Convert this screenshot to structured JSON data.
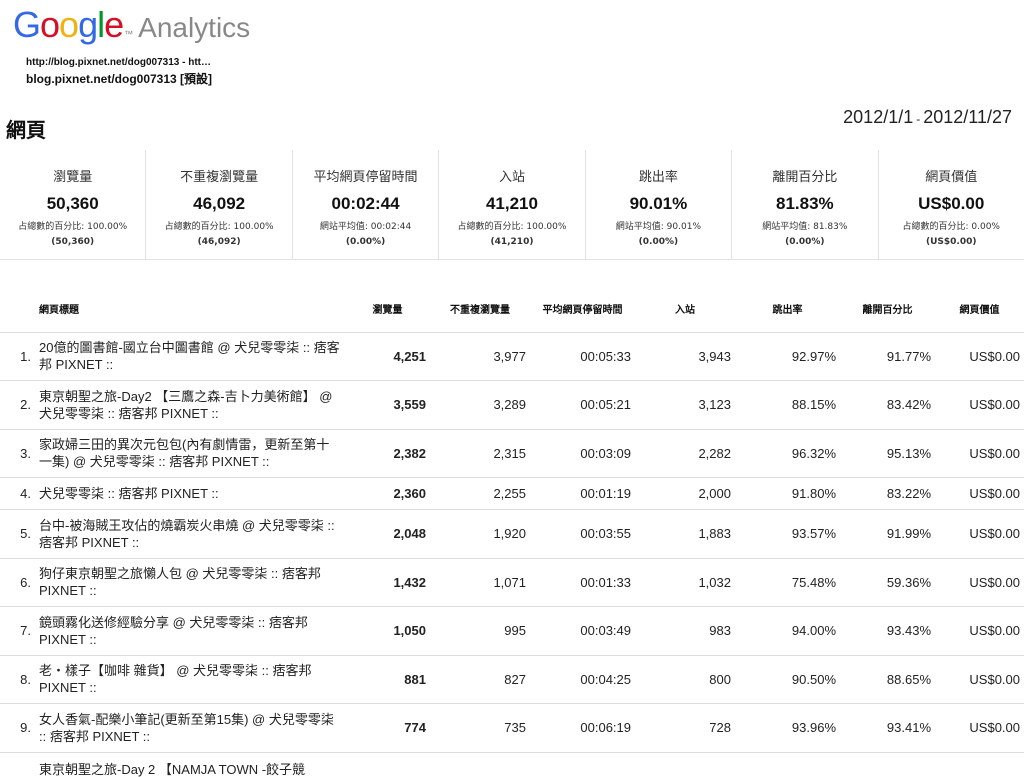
{
  "header": {
    "logo": {
      "letters": [
        {
          "char": "G",
          "color": "#3369e8"
        },
        {
          "char": "o",
          "color": "#d50f25"
        },
        {
          "char": "o",
          "color": "#eeb211"
        },
        {
          "char": "g",
          "color": "#3369e8"
        },
        {
          "char": "l",
          "color": "#009925"
        },
        {
          "char": "e",
          "color": "#d50f25"
        }
      ],
      "tm": "™",
      "product": "Analytics"
    },
    "account_url": "http://blog.pixnet.net/dog007313 - htt…",
    "account_name": "blog.pixnet.net/dog007313 [預設]",
    "page_title": "網頁",
    "date_start": "2012/1/1",
    "date_sep": "-",
    "date_end": "2012/11/27"
  },
  "metrics": [
    {
      "label": "瀏覽量",
      "value": "50,360",
      "sub": "占總數的百分比: 100.00%",
      "sub2": "(50,360)"
    },
    {
      "label": "不重複瀏覽量",
      "value": "46,092",
      "sub": "占總數的百分比: 100.00%",
      "sub2": "(46,092)"
    },
    {
      "label": "平均網頁停留時間",
      "value": "00:02:44",
      "sub": "網站平均值: 00:02:44",
      "sub2": "(0.00%)"
    },
    {
      "label": "入站",
      "value": "41,210",
      "sub": "占總數的百分比: 100.00%",
      "sub2": "(41,210)"
    },
    {
      "label": "跳出率",
      "value": "90.01%",
      "sub": "網站平均值: 90.01%",
      "sub2": "(0.00%)"
    },
    {
      "label": "離開百分比",
      "value": "81.83%",
      "sub": "網站平均值: 81.83%",
      "sub2": "(0.00%)"
    },
    {
      "label": "網頁價值",
      "value": "US$0.00",
      "sub": "占總數的百分比: 0.00%",
      "sub2": "(US$0.00)"
    }
  ],
  "table": {
    "columns": [
      "網頁標題",
      "瀏覽量",
      "不重複瀏覽量",
      "平均網頁停留時間",
      "入站",
      "跳出率",
      "離開百分比",
      "網頁價值"
    ],
    "rows": [
      {
        "idx": "1.",
        "title": "20億的圖書館-國立台中圖書館 @ 犬兒零零柒 :: 痞客邦 PIXNET ::",
        "views": "4,251",
        "unique": "3,977",
        "time": "00:05:33",
        "entrances": "3,943",
        "bounce": "92.97%",
        "exit": "91.77%",
        "value": "US$0.00"
      },
      {
        "idx": "2.",
        "title": "東京朝聖之旅-Day2 【三鷹之森-吉卜力美術館】 @ 犬兒零零柒 :: 痞客邦 PIXNET ::",
        "views": "3,559",
        "unique": "3,289",
        "time": "00:05:21",
        "entrances": "3,123",
        "bounce": "88.15%",
        "exit": "83.42%",
        "value": "US$0.00"
      },
      {
        "idx": "3.",
        "title": "家政婦三田的異次元包包(內有劇情雷，更新至第十一集) @ 犬兒零零柒 :: 痞客邦 PIXNET ::",
        "views": "2,382",
        "unique": "2,315",
        "time": "00:03:09",
        "entrances": "2,282",
        "bounce": "96.32%",
        "exit": "95.13%",
        "value": "US$0.00"
      },
      {
        "idx": "4.",
        "title": "犬兒零零柒 :: 痞客邦 PIXNET ::",
        "views": "2,360",
        "unique": "2,255",
        "time": "00:01:19",
        "entrances": "2,000",
        "bounce": "91.80%",
        "exit": "83.22%",
        "value": "US$0.00"
      },
      {
        "idx": "5.",
        "title": "台中-被海賊王攻佔的燒霸炭火串燒 @ 犬兒零零柒 :: 痞客邦 PIXNET ::",
        "views": "2,048",
        "unique": "1,920",
        "time": "00:03:55",
        "entrances": "1,883",
        "bounce": "93.57%",
        "exit": "91.99%",
        "value": "US$0.00"
      },
      {
        "idx": "6.",
        "title": "狗仔東京朝聖之旅懶人包 @ 犬兒零零柒 :: 痞客邦 PIXNET ::",
        "views": "1,432",
        "unique": "1,071",
        "time": "00:01:33",
        "entrances": "1,032",
        "bounce": "75.48%",
        "exit": "59.36%",
        "value": "US$0.00"
      },
      {
        "idx": "7.",
        "title": "鏡頭霧化送修經驗分享 @ 犬兒零零柒 :: 痞客邦 PIXNET ::",
        "views": "1,050",
        "unique": "995",
        "time": "00:03:49",
        "entrances": "983",
        "bounce": "94.00%",
        "exit": "93.43%",
        "value": "US$0.00"
      },
      {
        "idx": "8.",
        "title": "老‧樣子【咖啡 雜貨】 @ 犬兒零零柒 :: 痞客邦 PIXNET ::",
        "views": "881",
        "unique": "827",
        "time": "00:04:25",
        "entrances": "800",
        "bounce": "90.50%",
        "exit": "88.65%",
        "value": "US$0.00"
      },
      {
        "idx": "9.",
        "title": "女人香氣-配樂小筆記(更新至第15集) @ 犬兒零零柒 :: 痞客邦 PIXNET ::",
        "views": "774",
        "unique": "735",
        "time": "00:06:19",
        "entrances": "728",
        "bounce": "93.96%",
        "exit": "93.41%",
        "value": "US$0.00"
      },
      {
        "idx": "",
        "title": "東京朝聖之旅-Day 2 【NAMJA TOWN -餃子競",
        "views": "",
        "unique": "",
        "time": "",
        "entrances": "",
        "bounce": "",
        "exit": "",
        "value": ""
      }
    ]
  }
}
